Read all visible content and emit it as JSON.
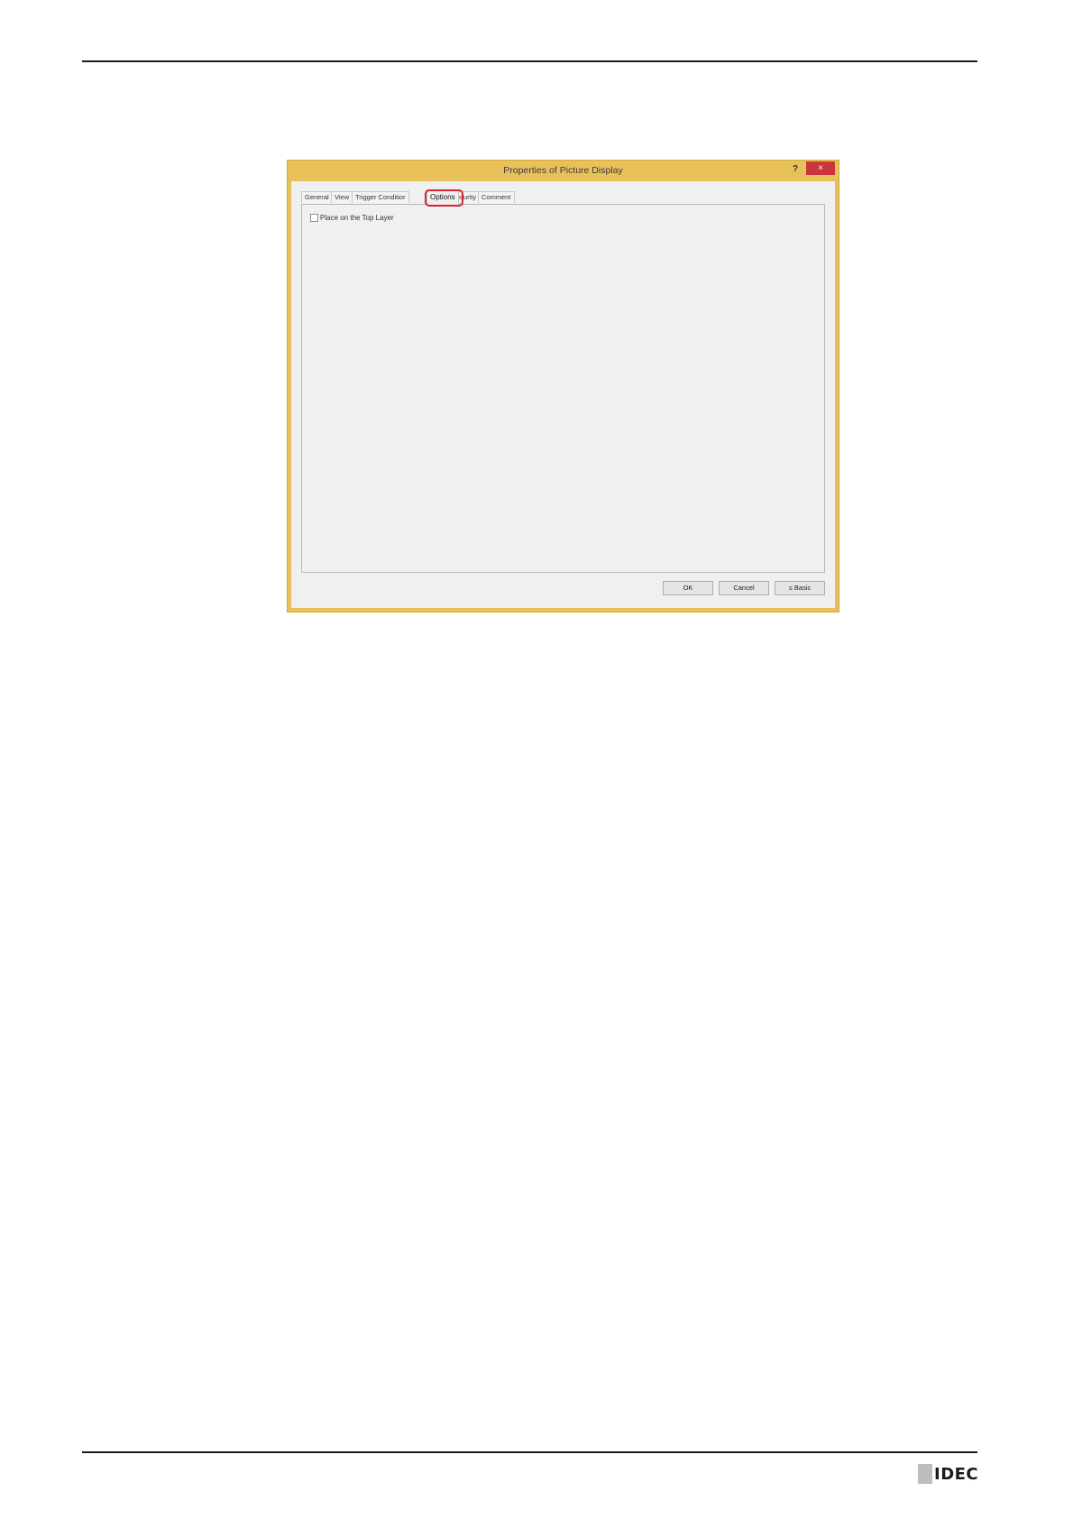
{
  "dialog": {
    "title": "Properties of Picture Display",
    "help_label": "?",
    "close_label": "×",
    "tabs": [
      {
        "label": "General",
        "active": false
      },
      {
        "label": "View",
        "active": false
      },
      {
        "label": "Trigger Conditior",
        "active": false
      },
      {
        "label": "Options",
        "active": true
      },
      {
        "label": "Security",
        "active": false
      },
      {
        "label": "Comment",
        "active": false
      }
    ],
    "options": {
      "place_top_layer_label": "Place on the Top Layer",
      "place_top_layer_checked": false
    },
    "buttons": {
      "ok": "OK",
      "cancel": "Cancel",
      "basic": "≤ Basic"
    }
  },
  "footer": {
    "logo_text": "IDEC"
  },
  "colors": {
    "dialog_frame": "#e9c15a",
    "close_button": "#c9353a",
    "highlight": "#d6262f"
  }
}
